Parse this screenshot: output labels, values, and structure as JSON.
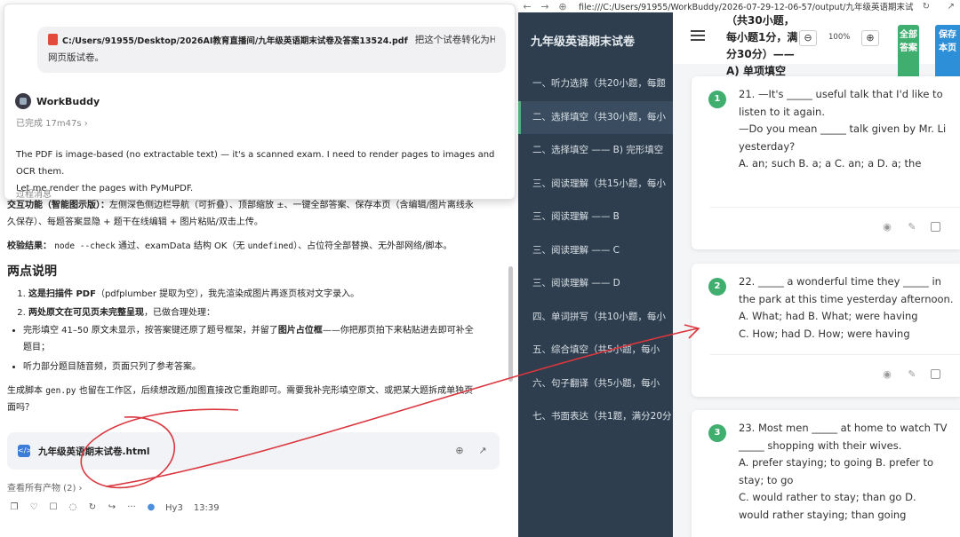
{
  "left_panel": {
    "top_strip": "…………………  ……………  ………",
    "user_message": {
      "pdf_path": "C:/Users/91955/Desktop/2026AI教育直播间/九年级英语期末试卷及答案13524.pdf",
      "request": "把这个试卷转化为HTML的交互式",
      "request_cont": "网页版试卷。"
    },
    "bot_name": "WorkBuddy",
    "status": "已完成 17m47s ›",
    "bot_text_1": "The PDF is image-based (no extractable text) — it's a scanned exam. I need to render pages to images and OCR them.",
    "bot_text_2": "Let me render the pages with PyMuPDF.",
    "process": "过程消息",
    "interaction_label": "交互功能（智能图示版）：",
    "interaction_text": "左侧深色侧边栏导航（可折叠）、顶部缩放 ±、一键全部答案、保存本页（含编辑/图片离线永",
    "interaction_text_2": "久保存）、每题答案显隐 + 题干在线编辑 + 图片粘贴/双击上传。",
    "check_label": "校验结果：",
    "check_code": "node --check",
    "check_text_1": "通过、examData 结构 OK（无",
    "check_code_2": "undefined",
    "check_text_2": "）、占位符全部替换、无外部网络/脚本。",
    "heading": "两点说明",
    "point1_bold": "这是扫描件 PDF",
    "point1_text": "（pdfplumber 提取为空），我先渲染成图片再逐页核对文字录入。",
    "point2_bold": "两处原文在可见页未完整呈现",
    "point2_text": "，已做合理处理：",
    "bullet1_text": "完形填空 41–50 原文未显示，按答案键还原了题号框架，并留了",
    "bullet1_bold": "图片占位框",
    "bullet1_text_2": "——你把那页拍下来粘贴进去即可补全",
    "bullet1_text_3": "题目；",
    "bullet2_text": "听力部分题目随音频，页面只列了参考答案。",
    "script_text_1": "生成脚本",
    "script_code": "gen.py",
    "script_text_2": "也留在工作区，后续想改题/加图直接改它重跑即可。需要我补完形填空原文、或把某大题拆成单独页",
    "script_text_3": "面吗？",
    "file_name": "九年级英语期末试卷.html",
    "see_all": "查看所有产物 (2) ›",
    "model": "Hy3",
    "time": "13:39"
  },
  "browser": {
    "url": "file:///C:/Users/91955/WorkBuddy/2026-07-29-12-06-57/output/九年级英语期末试",
    "sidebar_title": "九年级英语期末试卷",
    "nav": [
      "一、听力选择（共20小题，每题",
      "二、选择填空（共30小题，每小",
      "二、选择填空 —— B) 完形填空",
      "三、阅读理解（共15小题，每小",
      "三、阅读理解 —— B",
      "三、阅读理解 —— C",
      "三、阅读理解 —— D",
      "四、单词拼写（共10小题，每小",
      "五、综合填空（共5小题，每小",
      "六、句子翻译（共5小题，每小",
      "七、书面表达（共1题，满分20分"
    ],
    "header_line1": "（共30小题，",
    "header_line2": "每小题1分，满",
    "header_line3": "分30分）——",
    "header_line4": "A) 单项填空",
    "zoom": "100%",
    "btn_all": "全部答案",
    "btn_save": "保存本页",
    "questions": [
      {
        "num": "1",
        "lines": [
          "21. —It's _____ useful talk that I'd like to",
          "listen to it again.",
          "—Do you mean _____ talk given by Mr. Li",
          "yesterday?",
          "A. an; such    B. a; a    C. an; a    D. a; the"
        ]
      },
      {
        "num": "2",
        "lines": [
          "22. _____ a wonderful time they _____ in",
          "the park at this time yesterday afternoon.",
          "A. What; had    B. What; were having",
          "C. How; had    D. How; were having"
        ]
      },
      {
        "num": "3",
        "lines": [
          "23. Most men _____ at home to watch TV",
          "_____ shopping with their wives.",
          "A. prefer staying; to going    B. prefer to",
          "stay; to go",
          "C. would rather to stay; than go    D.",
          "would rather staying; than going"
        ]
      }
    ]
  },
  "colors": {
    "sidebar": "#2e3e4e",
    "accent_green": "#3fae6e",
    "accent_blue": "#2d8fd8",
    "annotation": "#d9363e"
  }
}
